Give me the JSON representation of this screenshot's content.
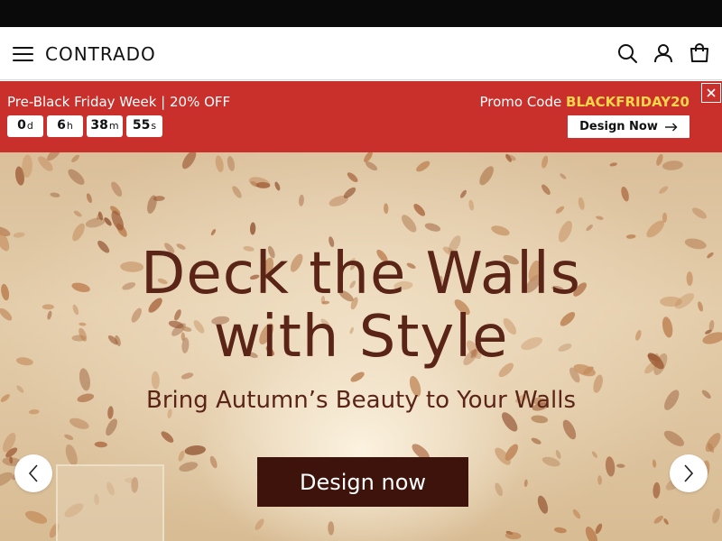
{
  "header": {
    "logo": "CONTRADO",
    "icons": [
      "menu-icon",
      "search-icon",
      "account-icon",
      "bag-icon"
    ]
  },
  "promo": {
    "title": "Pre-Black Friday Week | 20% OFF",
    "countdown": [
      {
        "value": "0",
        "unit": "d"
      },
      {
        "value": "6",
        "unit": "h"
      },
      {
        "value": "38",
        "unit": "m"
      },
      {
        "value": "55",
        "unit": "s"
      }
    ],
    "code_label": "Promo Code",
    "code": "BLACKFRIDAY20",
    "button_label": "Design Now",
    "background_color": "#c9302c",
    "code_color": "#ffd54a"
  },
  "hero": {
    "title_line1": "Deck the Walls",
    "title_line2": "with Style",
    "subtitle": "Bring Autumn’s Beauty to Your Walls",
    "cta_label": "Design now",
    "text_color": "#5a2417",
    "cta_color": "#3e130c",
    "prev_icon": "chevron-left-icon",
    "next_icon": "chevron-right-icon"
  }
}
